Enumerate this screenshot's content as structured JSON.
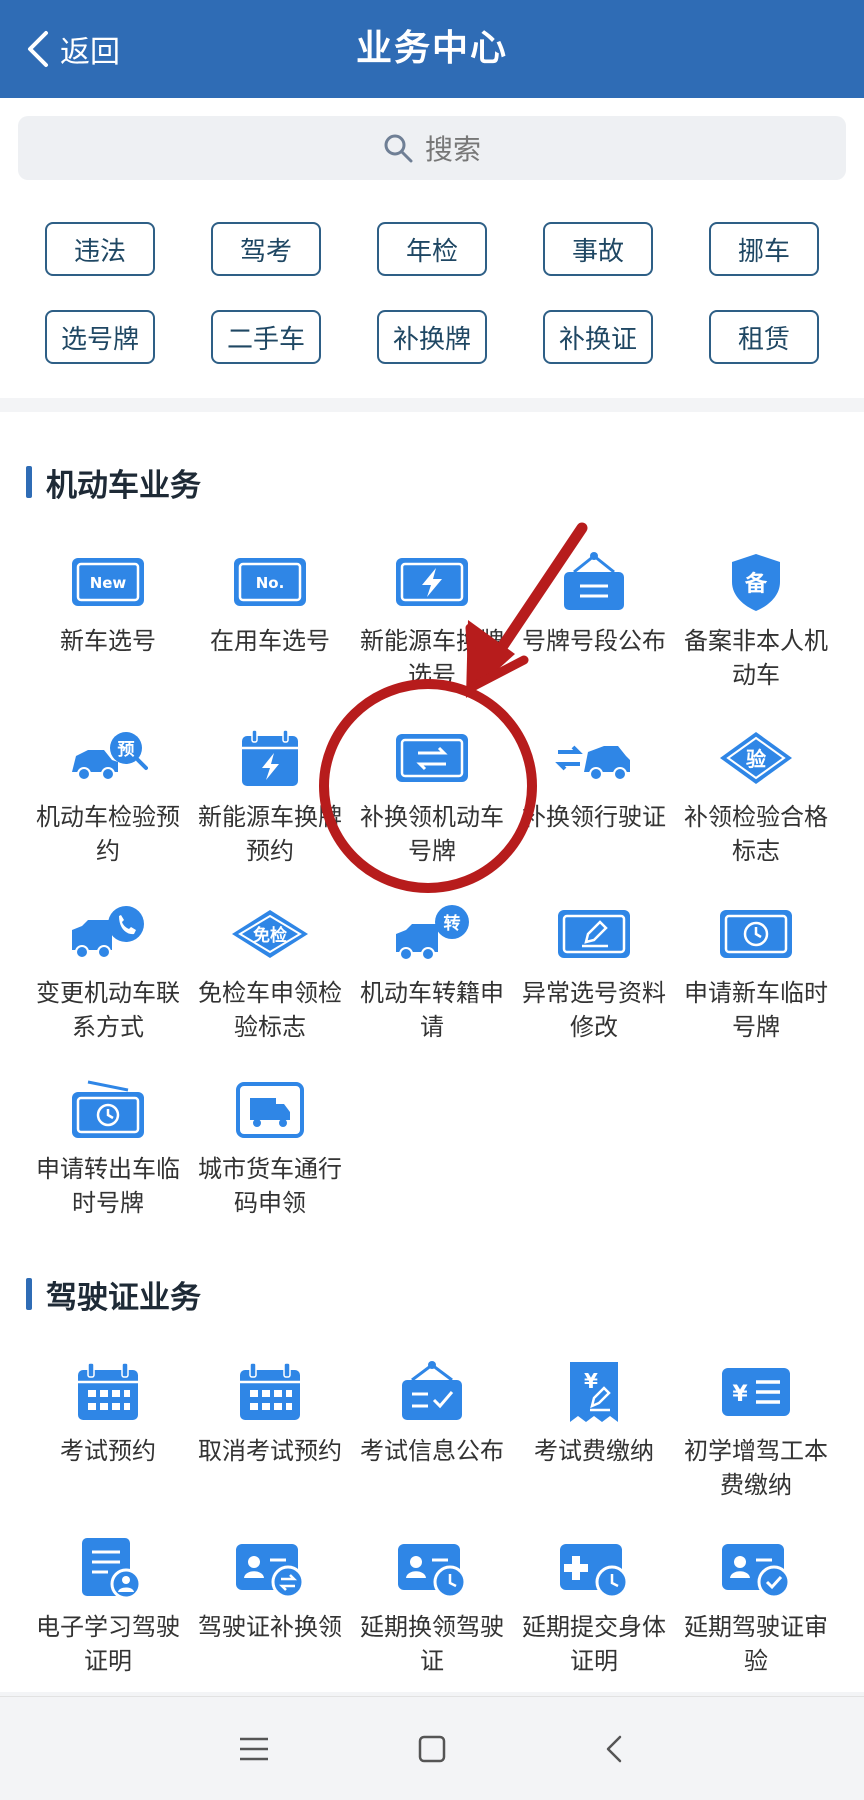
{
  "header": {
    "back_label": "返回",
    "title": "业务中心"
  },
  "search": {
    "placeholder": "搜索"
  },
  "quick_tags": [
    {
      "label": "违法"
    },
    {
      "label": "驾考"
    },
    {
      "label": "年检"
    },
    {
      "label": "事故"
    },
    {
      "label": "挪车"
    },
    {
      "label": "选号牌"
    },
    {
      "label": "二手车"
    },
    {
      "label": "补换牌"
    },
    {
      "label": "补换证"
    },
    {
      "label": "租赁"
    }
  ],
  "sections": [
    {
      "title": "机动车业务",
      "items": [
        {
          "label": "新车选号",
          "icon": "new-plate-icon"
        },
        {
          "label": "在用车选号",
          "icon": "number-plate-icon"
        },
        {
          "label": "新能源车换牌选号",
          "icon": "ev-plate-icon"
        },
        {
          "label": "号牌号段公布",
          "icon": "hanging-sign-icon"
        },
        {
          "label": "备案非本人机动车",
          "icon": "shield-record-icon"
        },
        {
          "label": "机动车检验预约",
          "icon": "car-inspection-icon"
        },
        {
          "label": "新能源车换牌预约",
          "icon": "ev-calendar-icon"
        },
        {
          "label": "补换领机动车号牌",
          "icon": "swap-plate-icon"
        },
        {
          "label": "补换领行驶证",
          "icon": "swap-car-icon"
        },
        {
          "label": "补领检验合格标志",
          "icon": "inspection-diamond-icon"
        },
        {
          "label": "变更机动车联系方式",
          "icon": "truck-phone-icon"
        },
        {
          "label": "免检车申领检验标志",
          "icon": "exempt-diamond-icon"
        },
        {
          "label": "机动车转籍申请",
          "icon": "truck-transfer-icon"
        },
        {
          "label": "异常选号资料修改",
          "icon": "edit-plate-icon"
        },
        {
          "label": "申请新车临时号牌",
          "icon": "temp-plate-icon"
        },
        {
          "label": "申请转出车临时号牌",
          "icon": "temp-plate-out-icon"
        },
        {
          "label": "城市货车通行码申领",
          "icon": "truck-pass-icon"
        }
      ]
    },
    {
      "title": "驾驶证业务",
      "items": [
        {
          "label": "考试预约",
          "icon": "calendar-icon"
        },
        {
          "label": "取消考试预约",
          "icon": "calendar-cancel-icon"
        },
        {
          "label": "考试信息公布",
          "icon": "info-sign-icon"
        },
        {
          "label": "考试费缴纳",
          "icon": "fee-receipt-icon"
        },
        {
          "label": "初学增驾工本费缴纳",
          "icon": "fee-list-icon"
        },
        {
          "label": "电子学习驾驶证明",
          "icon": "doc-person-icon"
        },
        {
          "label": "驾驶证补换领",
          "icon": "license-swap-icon"
        },
        {
          "label": "延期换领驾驶证",
          "icon": "license-clock-icon"
        },
        {
          "label": "延期提交身体证明",
          "icon": "health-clock-icon"
        },
        {
          "label": "延期驾驶证审验",
          "icon": "license-check-icon"
        }
      ]
    }
  ],
  "colors": {
    "header": "#2f6cb5",
    "icon": "#2f86e6",
    "tag_border": "#2e5f86",
    "annotation": "#b71c1c"
  }
}
